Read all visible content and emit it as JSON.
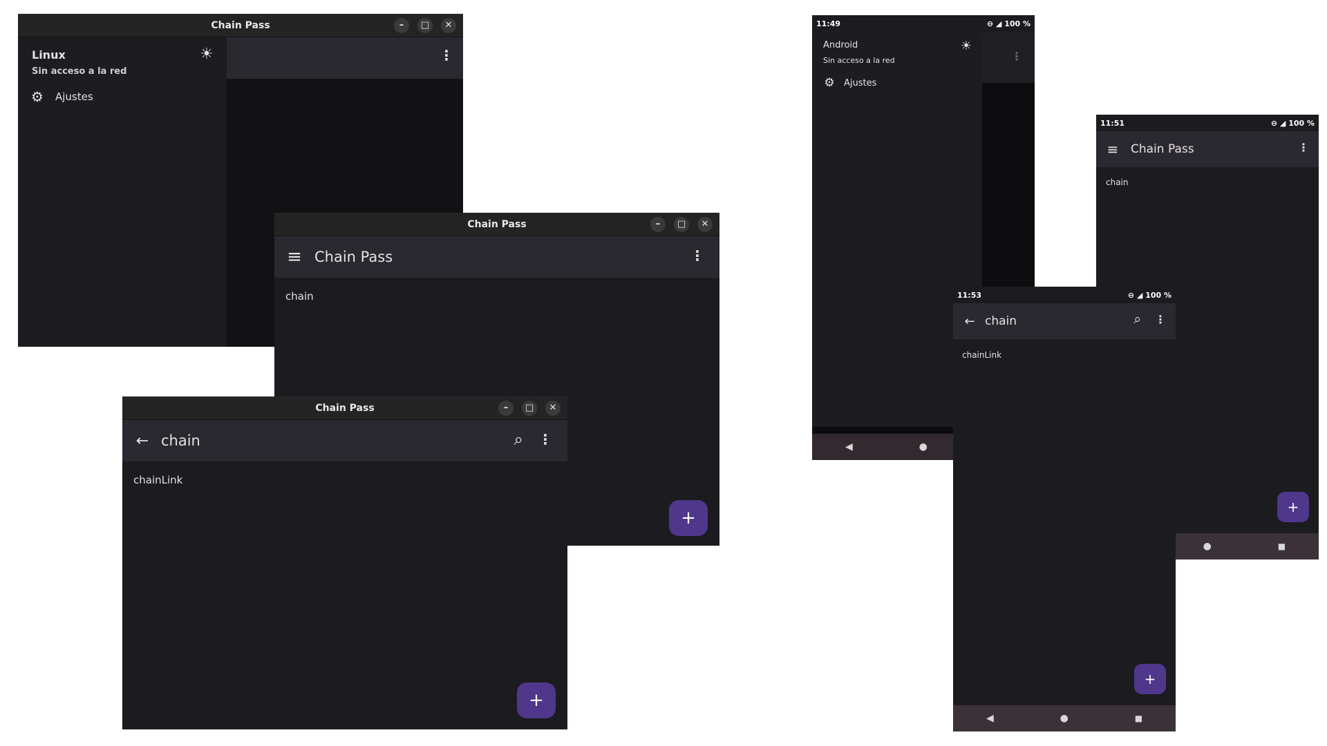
{
  "colors": {
    "surface": "#1c1b1f",
    "appbar": "#2b2930",
    "fab": "#4f378b",
    "titlebar": "#242424",
    "navbar": "#3a3238",
    "text": "#e6e1e5"
  },
  "linux_drawer": {
    "title": "Chain Pass",
    "drawer_title": "Linux",
    "drawer_subtitle": "Sin acceso a la red",
    "settings_label": "Ajustes",
    "icons": [
      "minimize-icon",
      "maximize-icon",
      "close-icon",
      "brightness-icon",
      "more-vert-icon",
      "gear-icon"
    ]
  },
  "linux_list": {
    "title": "Chain Pass",
    "appbar_title": "Chain Pass",
    "items": [
      "chain"
    ],
    "fab_label": "+",
    "icons": [
      "menu-icon",
      "more-vert-icon",
      "add-icon"
    ]
  },
  "linux_search": {
    "title": "Chain Pass",
    "query": "chain",
    "items": [
      "chainLink"
    ],
    "fab_label": "+",
    "icons": [
      "back-arrow-icon",
      "search-icon",
      "more-vert-icon",
      "add-icon"
    ]
  },
  "android_drawer": {
    "time": "11:49",
    "battery": "100 %",
    "drawer_title": "Android",
    "drawer_subtitle": "Sin acceso a la red",
    "settings_label": "Ajustes"
  },
  "android_list": {
    "time": "11:51",
    "battery": "100 %",
    "appbar_title": "Chain Pass",
    "items": [
      "chain"
    ],
    "fab_label": "+"
  },
  "android_search": {
    "time": "11:53",
    "battery": "100 %",
    "query": "chain",
    "items": [
      "chainLink"
    ],
    "fab_label": "+"
  },
  "window_controls": {
    "minimize": "–",
    "maximize": "□",
    "close": "✕"
  },
  "glyphs": {
    "menu": "≡",
    "more": "⋮",
    "back": "←",
    "gear": "⚙",
    "sun": "☀",
    "search": "⌕",
    "nav_back": "◀",
    "nav_home": "●",
    "nav_recent": "■",
    "status_icons": "⊖ ◢"
  }
}
